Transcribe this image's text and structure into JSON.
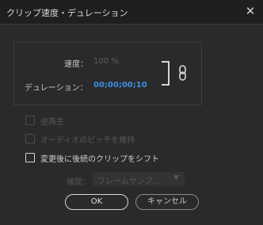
{
  "window": {
    "title": "クリップ速度・デュレーション",
    "close_glyph": "✕"
  },
  "speed": {
    "label": "速度：",
    "value": "100 %"
  },
  "duration": {
    "label": "デュレーション：",
    "value": "00;00;00;10"
  },
  "link": {
    "icon": "chain-link-icon",
    "linked": true
  },
  "options": {
    "reverse": {
      "label": "逆再生",
      "checked": false,
      "enabled": false
    },
    "maintain_pitch": {
      "label": "オーディオのピッチを維持",
      "checked": false,
      "enabled": false
    },
    "ripple_edit": {
      "label": "変更後に後続のクリップをシフト",
      "checked": false,
      "enabled": true
    }
  },
  "interpolation": {
    "label": "補間：",
    "selected": "フレームサンプ...",
    "enabled": false
  },
  "buttons": {
    "ok": "OK",
    "cancel": "キャンセル"
  },
  "colors": {
    "background": "#2a2a2a",
    "duration_value": "#3b8fe6"
  }
}
